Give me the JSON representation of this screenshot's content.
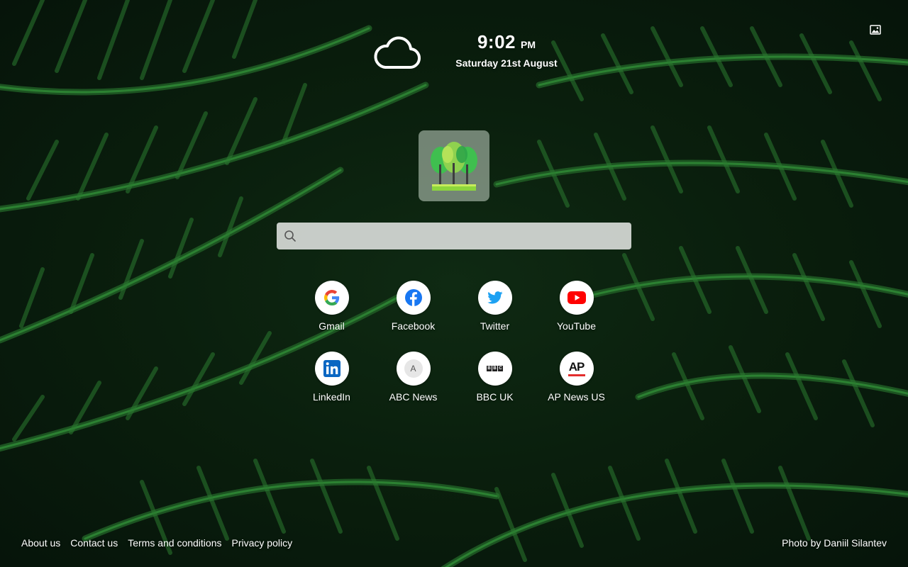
{
  "clock": {
    "time": "9:02",
    "ampm": "PM",
    "date": "Saturday 21st August"
  },
  "weather": {
    "icon": "cloud-icon"
  },
  "search": {
    "placeholder": "",
    "value": ""
  },
  "shortcuts": [
    {
      "label": "Gmail",
      "icon": "google-icon"
    },
    {
      "label": "Facebook",
      "icon": "facebook-icon"
    },
    {
      "label": "Twitter",
      "icon": "twitter-icon"
    },
    {
      "label": "YouTube",
      "icon": "youtube-icon"
    },
    {
      "label": "LinkedIn",
      "icon": "linkedin-icon"
    },
    {
      "label": "ABC News",
      "icon": "abc-news-icon",
      "glyph": "A"
    },
    {
      "label": "BBC UK",
      "icon": "bbc-icon",
      "glyph": "BBC"
    },
    {
      "label": "AP News US",
      "icon": "ap-news-icon",
      "glyph": "AP"
    }
  ],
  "footer": {
    "links": [
      "About us",
      "Contact us",
      "Terms and conditions",
      "Privacy policy"
    ],
    "credit": "Photo by Daniil Silantev"
  },
  "colors": {
    "background": "#0a1f0d",
    "fern": "#2e7d32",
    "facebook": "#1877f2",
    "twitter": "#1da1f2",
    "youtube": "#ff0000",
    "linkedin": "#0a66c2",
    "ap": "#e32d2d"
  }
}
